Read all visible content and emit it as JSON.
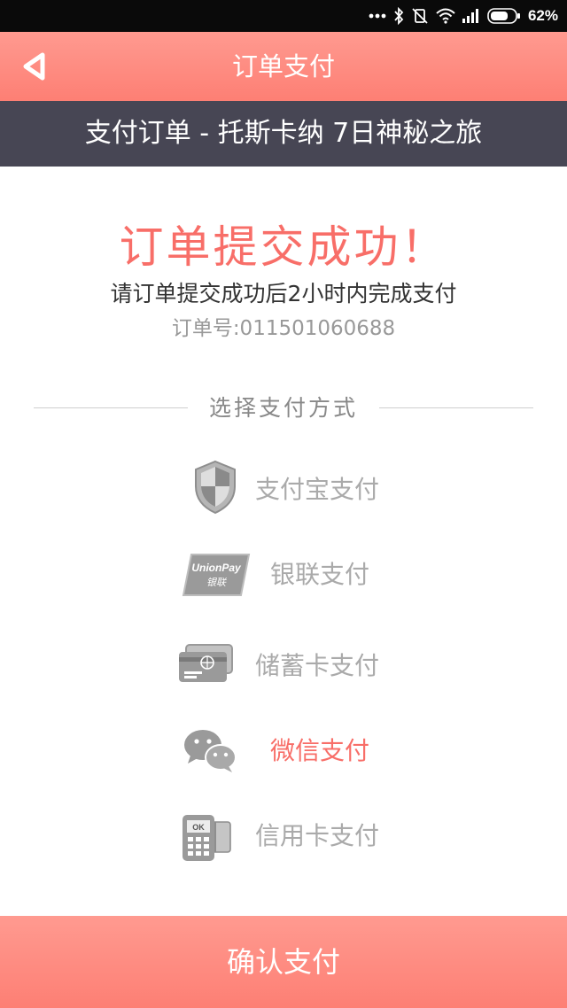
{
  "status_bar": {
    "battery_percent": "62%",
    "icons": [
      "more-dots-icon",
      "bluetooth-icon",
      "vibrate-off-icon",
      "wifi-icon",
      "signal-icon",
      "battery-icon"
    ]
  },
  "header": {
    "title": "订单支付",
    "back_icon": "back-triangle-icon"
  },
  "banner": {
    "text": "支付订单 - 托斯卡纳 7日神秘之旅"
  },
  "result": {
    "title": "订单提交成功！",
    "subtitle": "请订单提交成功后2小时内完成支付",
    "order_number": "订单号:011501060688"
  },
  "payment": {
    "section_label": "选择支付方式",
    "selected": "微信支付",
    "methods": [
      {
        "label": "支付宝支付",
        "icon": "shield-icon"
      },
      {
        "label": "银联支付",
        "icon": "unionpay-card-icon",
        "icon_text_1": "UnionPay",
        "icon_text_2": "银联"
      },
      {
        "label": "储蓄卡支付",
        "icon": "debit-card-icon"
      },
      {
        "label": "微信支付",
        "icon": "wechat-icon"
      },
      {
        "label": "信用卡支付",
        "icon": "card-terminal-icon",
        "icon_text_1": "OK"
      }
    ]
  },
  "footer": {
    "confirm_label": "确认支付"
  },
  "colors": {
    "accent": "#fd7f74",
    "active_text": "#f86e68",
    "banner_bg": "#474654",
    "inactive_text": "#aaaaaa"
  }
}
